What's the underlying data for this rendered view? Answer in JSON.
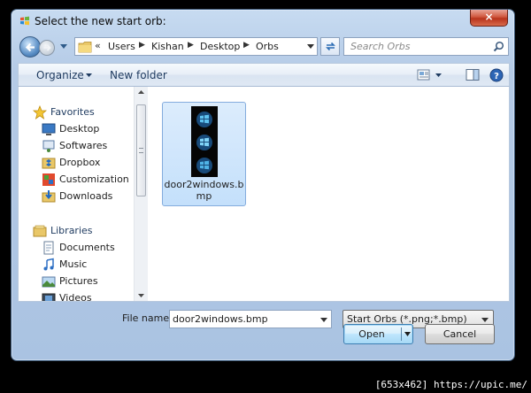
{
  "dialog": {
    "title": "Select the new start orb:",
    "close_label": "×"
  },
  "address": {
    "lead": "«",
    "crumbs": [
      "Users",
      "Kishan",
      "Desktop",
      "Orbs"
    ],
    "separator": "▶"
  },
  "search": {
    "placeholder": "Search Orbs"
  },
  "toolbar": {
    "organize_label": "Organize",
    "new_folder_label": "New folder"
  },
  "nav_pane": {
    "favorites_label": "Favorites",
    "favorites": [
      "Desktop",
      "Softwares",
      "Dropbox",
      "Customization",
      "Downloads"
    ],
    "libraries_label": "Libraries",
    "libraries": [
      "Documents",
      "Music",
      "Pictures",
      "Videos"
    ]
  },
  "files": [
    {
      "name_line1": "door2windows.b",
      "name_line2": "mp"
    }
  ],
  "footer": {
    "file_name_label": "File name:",
    "file_name_value": "door2windows.bmp",
    "filter_value": "Start Orbs (*.png;*.bmp)",
    "open_label": "Open",
    "cancel_label": "Cancel"
  },
  "watermark": "[653x462] https://upic.me/",
  "colors": {
    "window_frame": "#aac3e2",
    "selection": "#c4e0fb",
    "close_red": "#c7402a"
  }
}
